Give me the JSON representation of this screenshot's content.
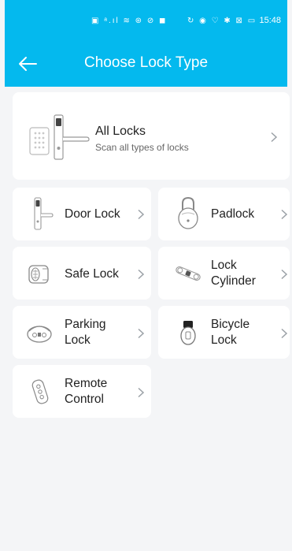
{
  "status_bar": {
    "left_icons": "▣ ᵃ.ıl ≋ ⊛ ⊘ ◼",
    "right_icons": "↻ ◉ ♡ ✱ ⊠ ▭",
    "time": "15:48"
  },
  "header": {
    "title": "Choose Lock Type",
    "back_icon": "arrow-left-icon"
  },
  "all_locks": {
    "title": "All Locks",
    "subtitle": "Scan all types of locks"
  },
  "lock_types": [
    {
      "line1": "Door Lock",
      "line2": ""
    },
    {
      "line1": "Padlock",
      "line2": ""
    },
    {
      "line1": "Safe Lock",
      "line2": ""
    },
    {
      "line1": "Lock",
      "line2": "Cylinder"
    },
    {
      "line1": "Parking",
      "line2": "Lock"
    },
    {
      "line1": "Bicycle",
      "line2": "Lock"
    },
    {
      "line1": "Remote",
      "line2": "Control"
    }
  ],
  "colors": {
    "header_bg": "#04b9ee",
    "page_bg": "#f4f5f7",
    "card_bg": "#ffffff",
    "chevron": "#9aa0a6"
  }
}
